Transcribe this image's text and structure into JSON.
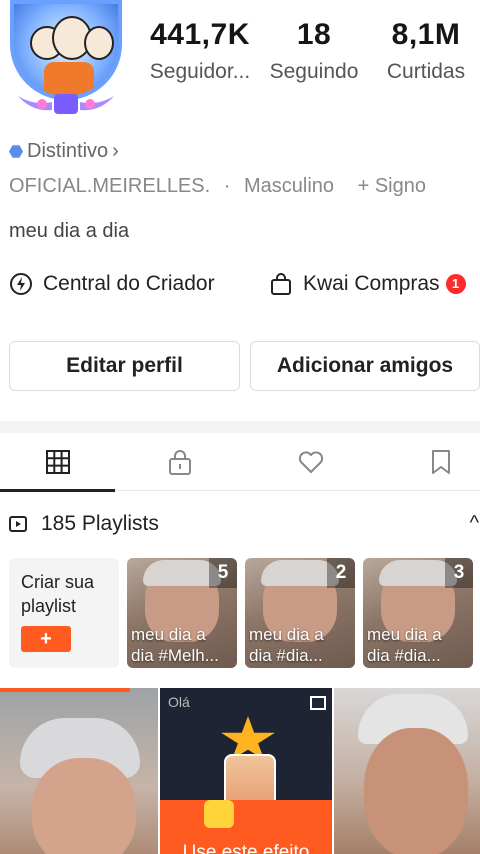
{
  "profile": {
    "stats": [
      {
        "value": "441,7K",
        "label": "Seguidor..."
      },
      {
        "value": "18",
        "label": "Seguindo"
      },
      {
        "value": "8,1M",
        "label": "Curtidas"
      }
    ],
    "badge_label": "Distintivo",
    "badge_chevron": "›",
    "info": {
      "name": "OFICIAL.MEIRELLES.",
      "separator": "·",
      "gender": "Masculino",
      "sign": "+ Signo"
    },
    "bio": "meu dia a dia"
  },
  "links": {
    "creator_center": "Central do Criador",
    "shop": "Kwai Compras",
    "shop_badge": "1"
  },
  "buttons": {
    "edit_profile": "Editar perfil",
    "add_friends": "Adicionar amigos"
  },
  "tabs": [
    "grid-icon",
    "lock-icon",
    "heart-icon",
    "bookmark-icon"
  ],
  "playlists": {
    "header": "185 Playlists",
    "collapse_glyph": "^",
    "create_label": "Criar sua playlist",
    "create_button": "+",
    "items": [
      {
        "count": "5",
        "caption": "meu dia a dia #Melh..."
      },
      {
        "count": "2",
        "caption": "meu dia a dia #dia..."
      },
      {
        "count": "3",
        "caption": "meu dia a dia #dia..."
      }
    ]
  },
  "videos": {
    "middle_card_small_text": "Olá",
    "effect_button": "Use este efeito"
  },
  "colors": {
    "accent": "#ff5a1f",
    "badge_red": "#ff2a2a",
    "distintivo_blue": "#5b8def"
  }
}
